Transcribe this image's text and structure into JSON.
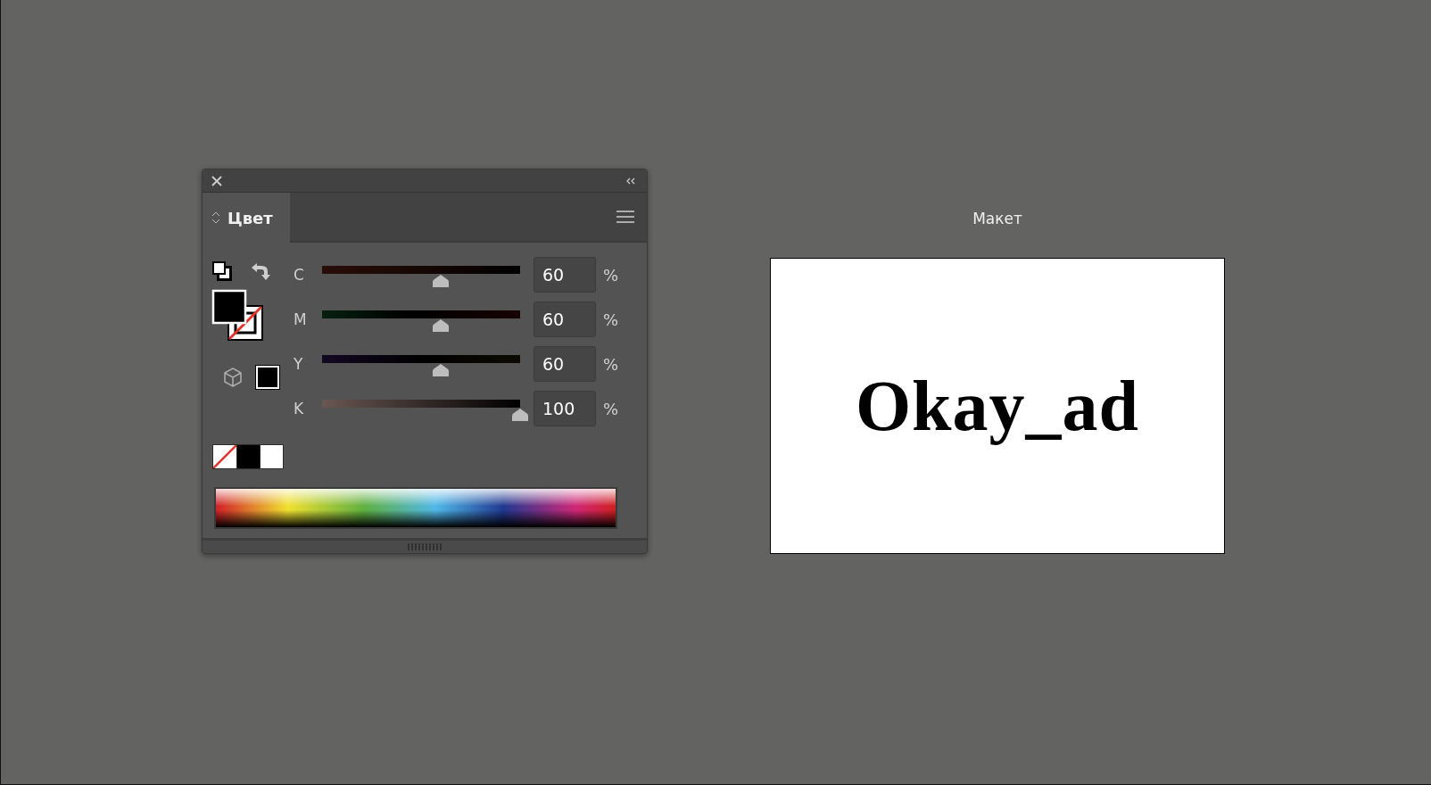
{
  "panel": {
    "title": "Цвет",
    "channels": [
      {
        "label": "C",
        "level": 0.6,
        "value": "60",
        "unit": "%"
      },
      {
        "label": "M",
        "level": 0.6,
        "value": "60",
        "unit": "%"
      },
      {
        "label": "Y",
        "level": 0.6,
        "value": "60",
        "unit": "%"
      },
      {
        "label": "K",
        "level": 1.0,
        "value": "100",
        "unit": "%"
      }
    ]
  },
  "artboard": {
    "label": "Макет",
    "text": "Okay_ad"
  }
}
